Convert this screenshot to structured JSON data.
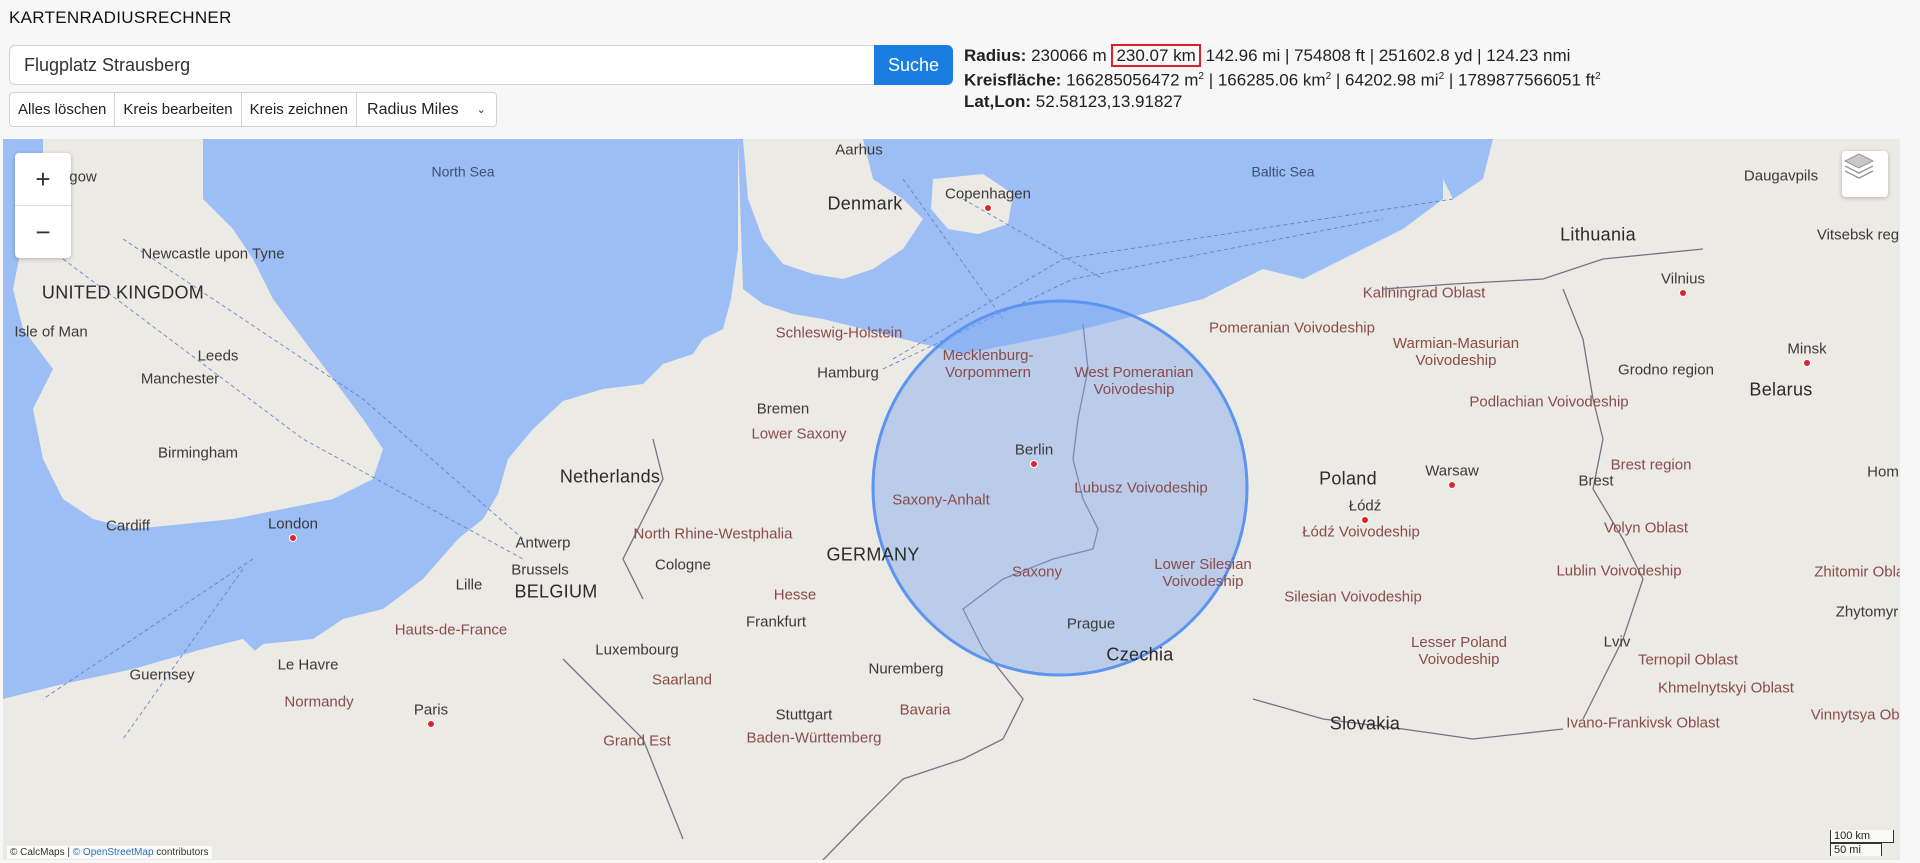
{
  "header": {
    "title": "KARTENRADIUSRECHNER"
  },
  "search": {
    "value": "Flugplatz Strausberg",
    "button": "Suche"
  },
  "toolbar": {
    "clear": "Alles löschen",
    "edit": "Kreis bearbeiten",
    "draw": "Kreis zeichnen",
    "unit_select": "Radius Miles"
  },
  "results": {
    "radius_label": "Radius:",
    "radius_m": "230066 m",
    "radius_km": "230.07 km",
    "radius_rest": "142.96 mi | 754808 ft | 251602.8 yd | 124.23 nmi",
    "area_label": "Kreisfläche:",
    "area_m2": "166285056472 m",
    "area_km2": " | 166285.06 km",
    "area_mi2": " | 64202.98 mi",
    "area_ft2": " | 1789877566051 ft",
    "sq": "2",
    "latlon_label": "Lat,Lon:",
    "latlon_value": "52.58123,13.91827"
  },
  "map": {
    "zoom_in": "+",
    "zoom_out": "−",
    "layers_icon": "layers-icon",
    "attribution_prefix": "© CalcMaps | ",
    "attribution_link": "© OpenStreetMap",
    "attribution_suffix": " contributors",
    "scale_km": "100 km",
    "scale_mi": "50 mi",
    "colors": {
      "water": "#9cbef5",
      "land": "#eceae4",
      "circle_fill": "#7fa8f2",
      "circle_stroke": "#5b95f0"
    },
    "labels": {
      "north_sea": "North Sea",
      "baltic_sea": "Baltic Sea",
      "denmark": "Denmark",
      "aarhus": "Aarhus",
      "copenhagen": "Copenhagen",
      "daugavpils": "Daugavpils",
      "lithuania": "Lithuania",
      "vitsebsk": "Vitsebsk reg",
      "vilnius": "Vilnius",
      "kaliningrad": "Kaliningrad Oblast",
      "minsk": "Minsk",
      "glasgow": "gow",
      "newcastle": "Newcastle upon Tyne",
      "uk": "UNITED KINGDOM",
      "isle_of_man": "Isle of Man",
      "leeds": "Leeds",
      "manchester": "Manchester",
      "birmingham": "Birmingham",
      "cardiff": "Cardiff",
      "london": "London",
      "schleswig": "Schleswig-Holstein",
      "hamburg": "Hamburg",
      "mecklenburg": "Mecklenburg-Vorpommern",
      "west_pomeranian": "West Pomeranian Voivodeship",
      "pomeranian": "Pomeranian Voivodeship",
      "warmian": "Warmian-Masurian Voivodeship",
      "grodno": "Grodno region",
      "belarus": "Belarus",
      "podlachian": "Podlachian Voivodeship",
      "bremen": "Bremen",
      "lower_saxony": "Lower Saxony",
      "berlin": "Berlin",
      "netherlands": "Netherlands",
      "saxony_anhalt": "Saxony-Anhalt",
      "lubusz": "Lubusz Voivodeship",
      "poland": "Poland",
      "warsaw": "Warsaw",
      "brest": "Brest",
      "brest_region": "Brest region",
      "hom": "Hom",
      "lodz": "Łódź",
      "lodz_voiv": "Łódź Voivodeship",
      "volyn": "Volyn Oblast",
      "north_rhine": "North Rhine-Westphalia",
      "antwerp": "Antwerp",
      "brussels": "Brussels",
      "cologne": "Cologne",
      "germany": "GERMANY",
      "saxony": "Saxony",
      "lower_silesian": "Lower Silesian Voivodeship",
      "lublin": "Lublin Voivodeship",
      "zhitomir": "Zhitomir Oblas",
      "lille": "Lille",
      "belgium": "BELGIUM",
      "hesse": "Hesse",
      "silesian": "Silesian Voivodeship",
      "zhytomyr": "Zhytomyr",
      "hauts": "Hauts-de-France",
      "frankfurt": "Frankfurt",
      "prague": "Prague",
      "luxembourg": "Luxembourg",
      "czechia": "Czechia",
      "lesser_poland": "Lesser Poland Voivodeship",
      "lviv": "Lviv",
      "ternopil": "Ternopil Oblast",
      "le_havre": "Le Havre",
      "guernsey": "Guernsey",
      "nuremberg": "Nuremberg",
      "saarland": "Saarland",
      "khmelnytskyi": "Khmelnytskyi Oblast",
      "normandy": "Normandy",
      "paris": "Paris",
      "bavaria": "Bavaria",
      "stuttgart": "Stuttgart",
      "ivano": "Ivano-Frankivsk Oblast",
      "slovakia": "Slovakia",
      "grand_est": "Grand Est",
      "baden": "Baden-Württemberg",
      "vinnytsya": "Vinnytsya Obla"
    }
  }
}
